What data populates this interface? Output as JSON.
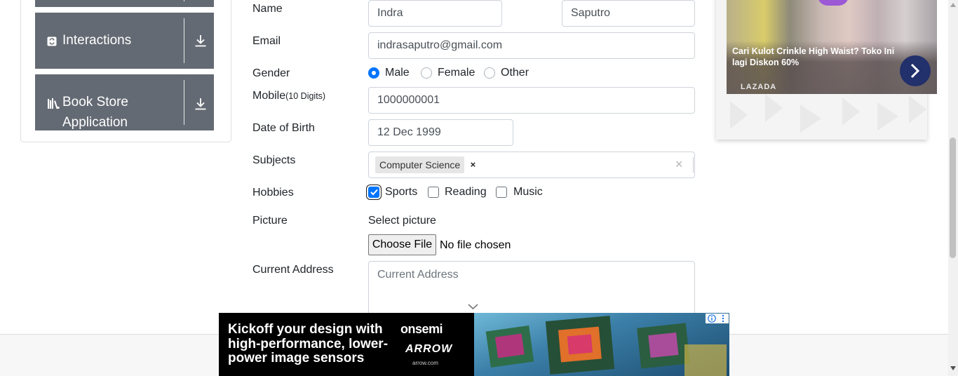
{
  "sidebar": {
    "groups": [
      {
        "label": "Interactions",
        "icon": "interactions-icon"
      },
      {
        "label": "Book Store Application",
        "label_line1": "Book Store",
        "label_line2": "Application",
        "icon": "book-store-icon"
      }
    ]
  },
  "form": {
    "name_label": "Name",
    "first_name": "Indra",
    "last_name": "Saputro",
    "email_label": "Email",
    "email": "indrasaputro@gmail.com",
    "gender_label": "Gender",
    "gender_options": [
      "Male",
      "Female",
      "Other"
    ],
    "gender_selected": "Male",
    "mobile_label": "Mobile",
    "mobile_hint": "(10 Digits)",
    "mobile": "1000000001",
    "dob_label": "Date of Birth",
    "dob": "12 Dec 1999",
    "subjects_label": "Subjects",
    "subjects": [
      "Computer Science"
    ],
    "hobbies_label": "Hobbies",
    "hobbies": [
      "Sports",
      "Reading",
      "Music"
    ],
    "hobbies_checked": [
      "Sports"
    ],
    "picture_label": "Picture",
    "select_picture": "Select picture",
    "choose_file": "Choose File",
    "no_file": "No file chosen",
    "address_label": "Current Address",
    "address_placeholder": "Current Address"
  },
  "side_ad": {
    "title": "Cari Kulot Crinkle High Waist? Toko Ini lagi Diskon 60%",
    "brand": "LAZADA"
  },
  "bottom_ad": {
    "headline": "Kickoff your design with high-performance, lower-power image sensors",
    "brand1": "onsemi",
    "brand2": "ARROW",
    "url": "arrow.com"
  },
  "colors": {
    "sidebar_bg": "#646a73",
    "accent": "#0075ff",
    "ad_arrow": "#22306b"
  }
}
